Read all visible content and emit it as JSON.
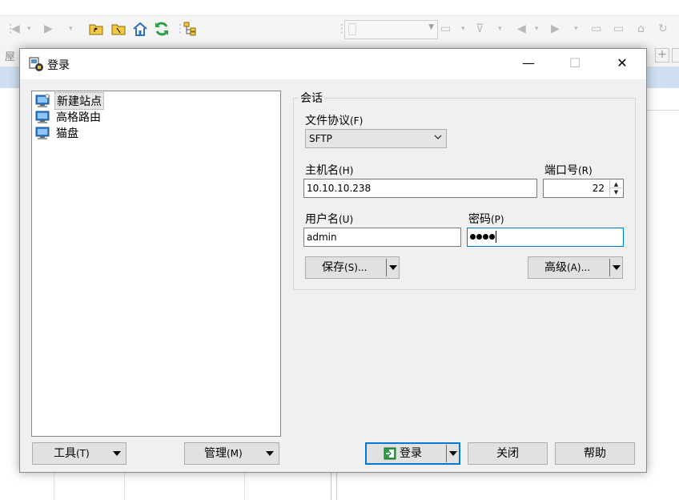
{
  "background": {
    "left_char": "屋",
    "plus": "+"
  },
  "dialog": {
    "title": "登录",
    "sites": [
      {
        "label": "新建站点",
        "selected": true
      },
      {
        "label": "高格路由",
        "selected": false
      },
      {
        "label": "猫盘",
        "selected": false
      }
    ],
    "session": {
      "group_label": "会话",
      "protocol_label": "文件协议",
      "protocol_accel": "(F)",
      "protocol_value": "SFTP",
      "host_label": "主机名",
      "host_accel": "(H)",
      "host_value": "10.10.10.238",
      "port_label": "端口号",
      "port_accel": "(R)",
      "port_value": "22",
      "user_label": "用户名",
      "user_accel": "(U)",
      "user_value": "admin",
      "password_label": "密码",
      "password_accel": "(P)",
      "password_dots": 4,
      "save_label": "保存",
      "save_accel": "(S)...",
      "advanced_label": "高级",
      "advanced_accel": "(A)..."
    },
    "buttons": {
      "tools_label": "工具",
      "tools_accel": "(T)",
      "manage_label": "管理",
      "manage_accel": "(M)",
      "login_label": "登录",
      "close_label": "关闭",
      "help_label": "帮助"
    },
    "window_controls": {
      "minimize": "—",
      "maximize": "☐",
      "close": "✕"
    }
  },
  "colors": {
    "accent": "#0078d7",
    "folder": "#e8b20e",
    "refresh": "#2ea043",
    "home": "#2f6fbf"
  }
}
